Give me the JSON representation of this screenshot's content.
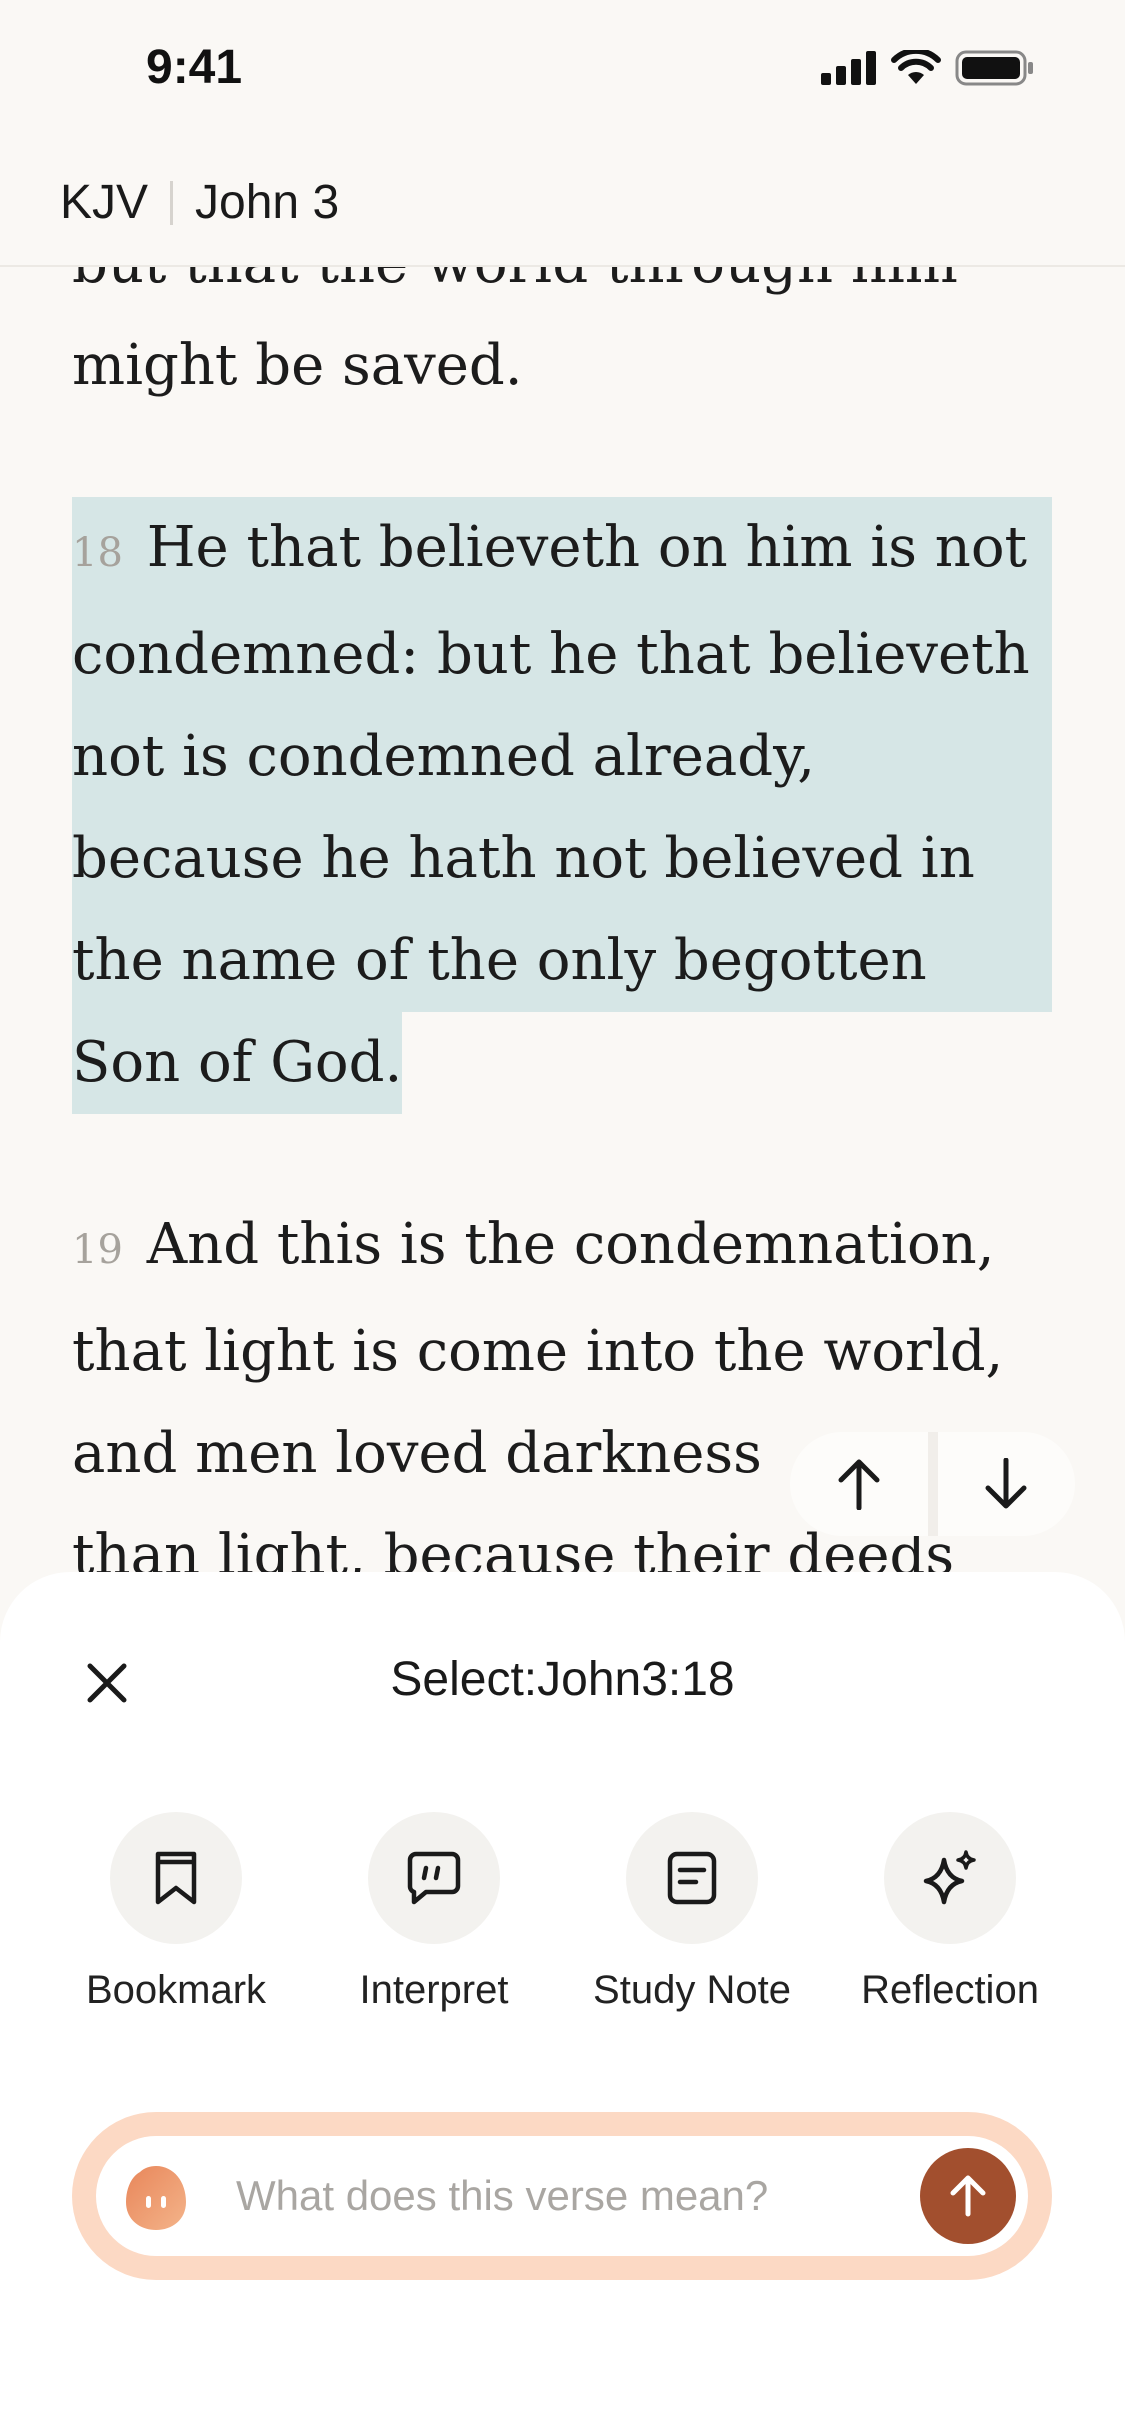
{
  "status_bar": {
    "time": "9:41"
  },
  "header": {
    "version": "KJV",
    "chapter": "John 3"
  },
  "scripture": {
    "previous_fragment": [
      "but that the world through him",
      "might be saved."
    ],
    "verses": [
      {
        "number": "18",
        "lines": [
          "He that believeth on him is not",
          "condemned: but he that believeth",
          "not is condemned already,",
          "because he hath not believed in",
          "the name of the only begotten",
          "Son of God."
        ],
        "highlighted": true
      },
      {
        "number": "19",
        "lines": [
          "And this is the condemnation,",
          "that light is come into the world,",
          "and men loved darkness",
          "than light, because their deeds"
        ],
        "highlighted": false
      }
    ],
    "highlight_color": "#d6e6e6"
  },
  "nav": {
    "up_icon": "arrow-up-icon",
    "down_icon": "arrow-down-icon"
  },
  "sheet": {
    "title": "Select:John3:18",
    "close_icon": "close-icon",
    "actions": [
      {
        "label": "Bookmark",
        "icon": "bookmark-icon"
      },
      {
        "label": "Interpret",
        "icon": "chat-quote-icon"
      },
      {
        "label": "Study Note",
        "icon": "note-icon"
      },
      {
        "label": "Reflection",
        "icon": "sparkle-icon"
      }
    ],
    "ask": {
      "placeholder": "What does this verse mean?",
      "avatar_icon": "assistant-avatar-icon",
      "send_icon": "send-arrow-icon"
    }
  },
  "colors": {
    "accent": "#a24f2e",
    "ask_border": "#fcd9c4",
    "background": "#faf8f5"
  }
}
